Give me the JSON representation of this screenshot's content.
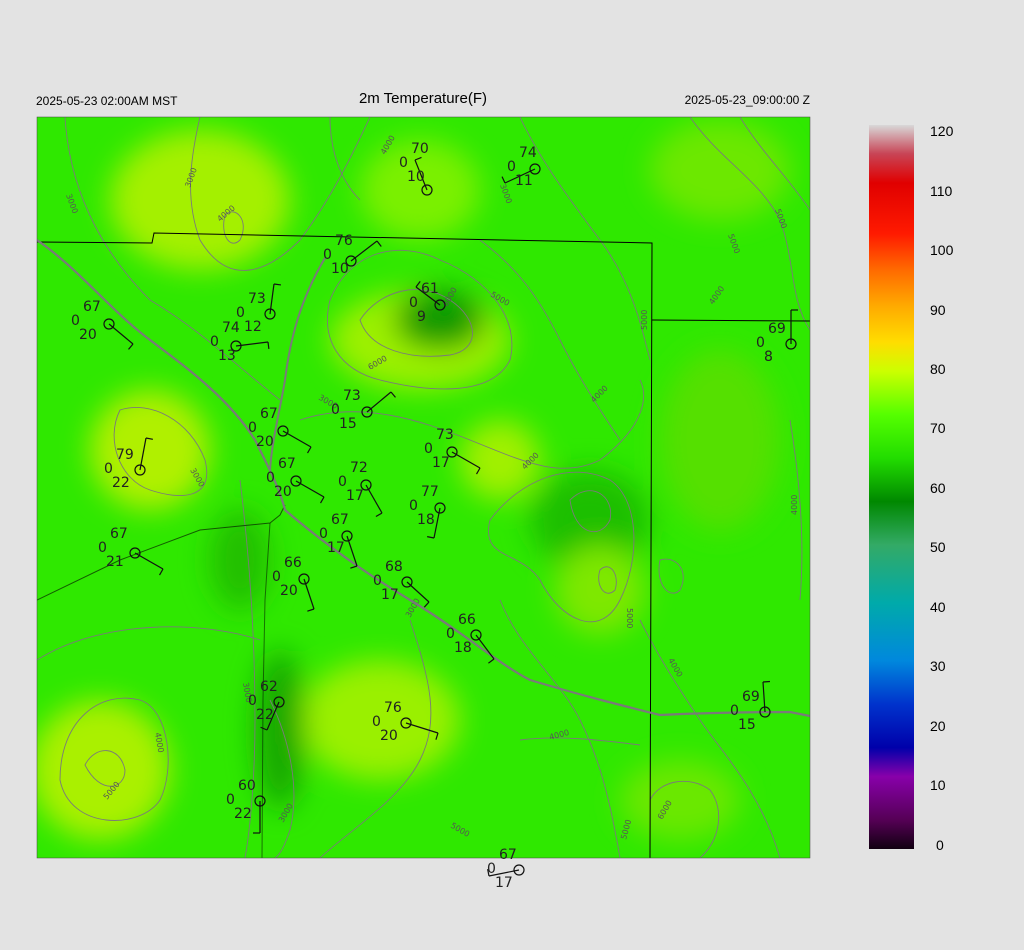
{
  "header": {
    "local_time": "2025-05-23 02:00AM MST",
    "title": "2m Temperature(F)",
    "valid_time": "2025-05-23_09:00:00 Z"
  },
  "colorbar": {
    "ticks": [
      "120",
      "110",
      "100",
      "90",
      "80",
      "70",
      "60",
      "50",
      "40",
      "30",
      "20",
      "10",
      "0"
    ],
    "colors": [
      "#d8d8d8",
      "#cc3344",
      "#e00000",
      "#ff3300",
      "#ff8800",
      "#ffcc00",
      "#ccff00",
      "#44ff00",
      "#00cc00",
      "#008800",
      "#33aa88",
      "#00aaaa",
      "#0088dd",
      "#0033dd",
      "#0000aa",
      "#8800aa",
      "#220022"
    ]
  },
  "contour_labels": [
    "3000",
    "4000",
    "5000",
    "6000"
  ],
  "stations": [
    {
      "t": "70",
      "d": "10",
      "c": "0"
    },
    {
      "t": "74",
      "d": "11",
      "c": "0"
    },
    {
      "t": "76",
      "d": "10",
      "c": "0"
    },
    {
      "t": "61",
      "d": "9",
      "c": "0"
    },
    {
      "t": "73",
      "d": "12",
      "c": "0"
    },
    {
      "t": "67",
      "d": "20",
      "c": "0"
    },
    {
      "t": "74",
      "d": "13",
      "c": "0"
    },
    {
      "t": "69",
      "d": "8",
      "c": "0"
    },
    {
      "t": "73",
      "d": "15",
      "c": "0"
    },
    {
      "t": "67",
      "d": "20",
      "c": "0"
    },
    {
      "t": "79",
      "d": "22",
      "c": "0"
    },
    {
      "t": "73",
      "d": "17",
      "c": "0"
    },
    {
      "t": "67",
      "d": "20",
      "c": "0"
    },
    {
      "t": "72",
      "d": "17",
      "c": "0"
    },
    {
      "t": "77",
      "d": "18",
      "c": "0"
    },
    {
      "t": "67",
      "d": "21",
      "c": "0"
    },
    {
      "t": "67",
      "d": "17",
      "c": "0"
    },
    {
      "t": "66",
      "d": "20",
      "c": "0"
    },
    {
      "t": "68",
      "d": "17",
      "c": "0"
    },
    {
      "t": "66",
      "d": "18",
      "c": "0"
    },
    {
      "t": "62",
      "d": "22",
      "c": "0"
    },
    {
      "t": "69",
      "d": "15",
      "c": "0"
    },
    {
      "t": "76",
      "d": "20",
      "c": "0"
    },
    {
      "t": "60",
      "d": "22",
      "c": "0"
    },
    {
      "t": "67",
      "d": "17",
      "c": "0"
    }
  ]
}
